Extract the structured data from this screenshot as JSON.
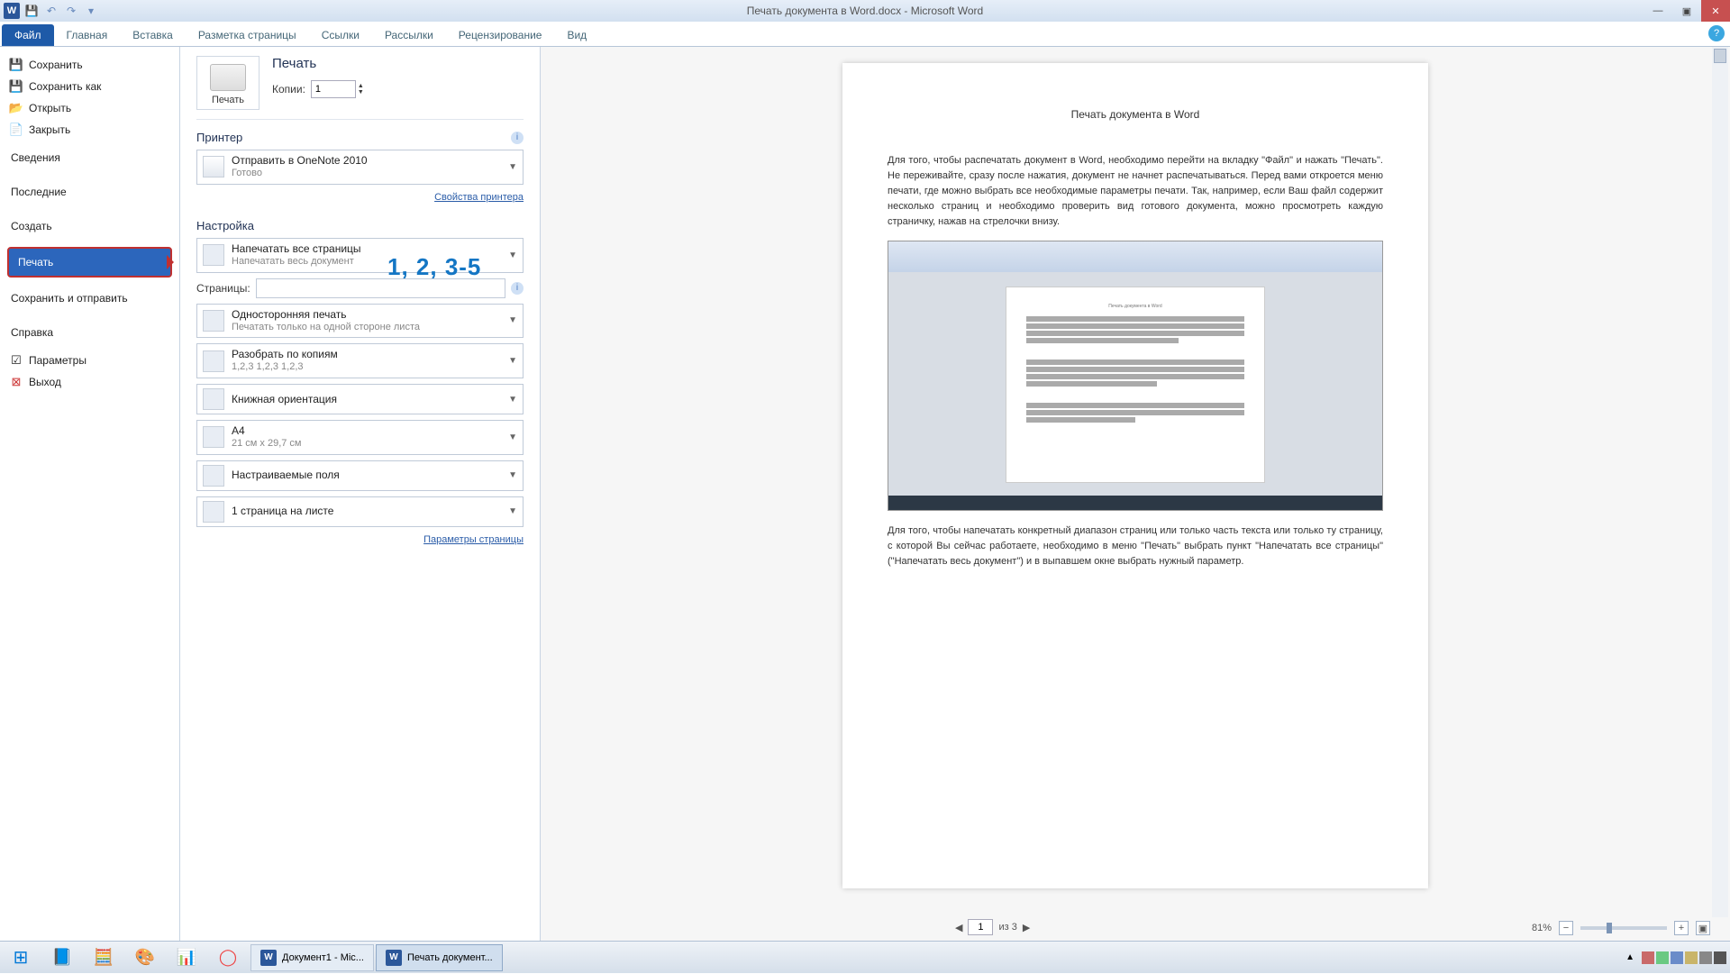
{
  "titlebar": {
    "title": "Печать документа в Word.docx - Microsoft Word"
  },
  "ribbon": {
    "file": "Файл",
    "tabs": [
      "Главная",
      "Вставка",
      "Разметка страницы",
      "Ссылки",
      "Рассылки",
      "Рецензирование",
      "Вид"
    ]
  },
  "filemenu": {
    "save": "Сохранить",
    "saveas": "Сохранить как",
    "open": "Открыть",
    "close": "Закрыть",
    "info": "Сведения",
    "recent": "Последние",
    "new": "Создать",
    "print": "Печать",
    "share": "Сохранить и отправить",
    "help": "Справка",
    "options": "Параметры",
    "exit": "Выход"
  },
  "print": {
    "title": "Печать",
    "button": "Печать",
    "copies_label": "Копии:",
    "copies_value": "1",
    "printer_section": "Принтер",
    "printer_name": "Отправить в OneNote 2010",
    "printer_status": "Готово",
    "printer_props": "Свойства принтера",
    "settings_section": "Настройка",
    "opt_range_t": "Напечатать все страницы",
    "opt_range_s": "Напечатать весь документ",
    "pages_label": "Страницы:",
    "pages_value": "",
    "pages_overlay": "1, 2, 3-5",
    "opt_side_t": "Односторонняя печать",
    "opt_side_s": "Печатать только на одной стороне листа",
    "opt_collate_t": "Разобрать по копиям",
    "opt_collate_s": "1,2,3   1,2,3   1,2,3",
    "opt_orient": "Книжная ориентация",
    "opt_size_t": "A4",
    "opt_size_s": "21 см x 29,7 см",
    "opt_margins": "Настраиваемые поля",
    "opt_ppp": "1 страница на листе",
    "page_setup": "Параметры страницы"
  },
  "preview": {
    "doc_title": "Печать документа в Word",
    "para1": "Для того, чтобы распечатать документ в Word, необходимо перейти на вкладку \"Файл\" и нажать \"Печать\". Не переживайте, сразу после нажатия, документ не начнет распечатываться. Перед вами откроется меню печати, где можно выбрать все необходимые параметры печати. Так, например, если Ваш файл содержит несколько страниц и необходимо проверить вид готового документа, можно просмотреть каждую страничку, нажав на стрелочки внизу.",
    "para2": "Для того, чтобы напечатать конкретный диапазон страниц или только часть текста или только ту страницу, с которой Вы сейчас работаете, необходимо в меню \"Печать\" выбрать пункт \"Напечатать все страницы\" (\"Напечатать весь документ\") и в выпавшем окне выбрать нужный параметр.",
    "pager_of": "из 3",
    "pager_current": "1",
    "zoom": "81%"
  },
  "taskbar": {
    "tasks": [
      "Документ1 - Mic...",
      "Печать документ..."
    ]
  }
}
